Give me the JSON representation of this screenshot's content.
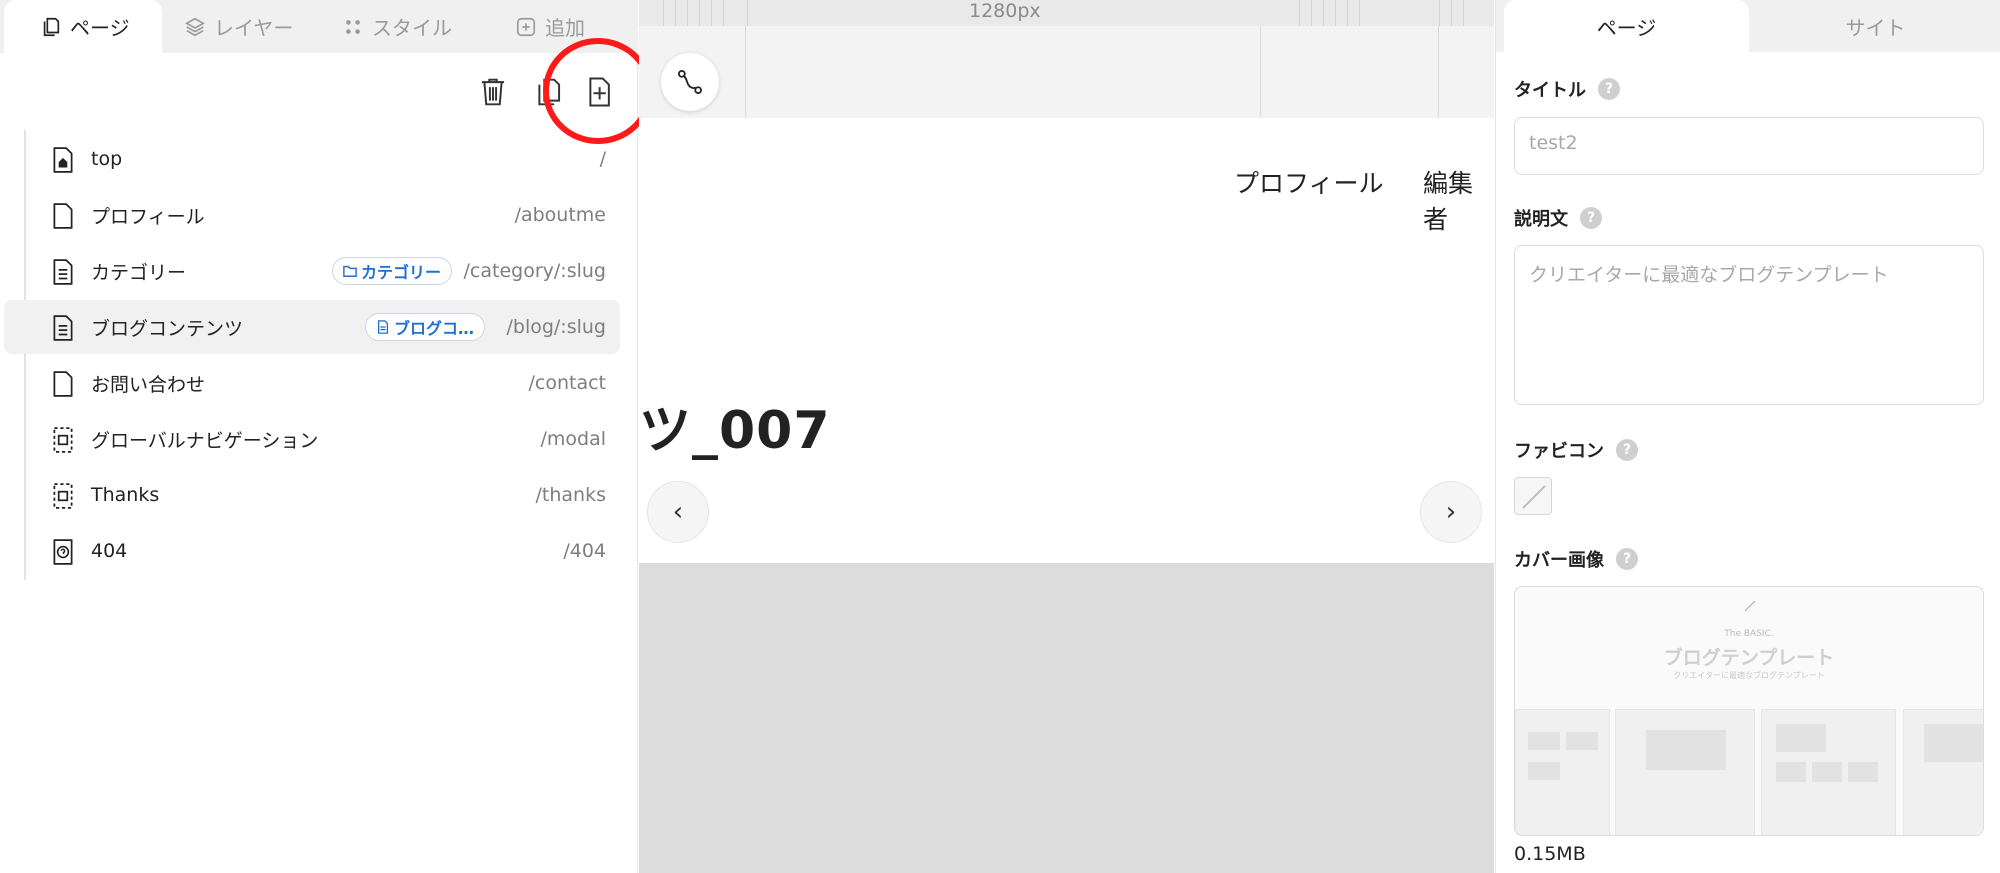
{
  "left_panel": {
    "tabs": [
      {
        "label": "ページ",
        "icon": "pages-icon",
        "active": true
      },
      {
        "label": "レイヤー",
        "icon": "layers-icon",
        "active": false
      },
      {
        "label": "スタイル",
        "icon": "style-icon",
        "active": false
      },
      {
        "label": "追加",
        "icon": "plus-square-icon",
        "active": false
      }
    ],
    "toolbar": [
      "trash-icon",
      "duplicate-icon",
      "add-page-icon"
    ],
    "pages": [
      {
        "name": "top",
        "path": "/",
        "icon": "home-page-icon",
        "tag": "",
        "selected": false
      },
      {
        "name": "プロフィール",
        "path": "/aboutme",
        "icon": "page-icon",
        "tag": "",
        "selected": false
      },
      {
        "name": "カテゴリー",
        "path": "/category/:slug",
        "icon": "document-icon",
        "tag": "カテゴリー",
        "tag_icon": "folder-icon",
        "selected": false
      },
      {
        "name": "ブログコンテンツ",
        "path": "/blog/:slug",
        "icon": "document-icon",
        "tag": "ブログコ…",
        "tag_icon": "document-small-icon",
        "selected": true
      },
      {
        "name": "お問い合わせ",
        "path": "/contact",
        "icon": "page-icon",
        "tag": "",
        "selected": false
      },
      {
        "name": "グローバルナビゲーション",
        "path": "/modal",
        "icon": "modal-icon",
        "tag": "",
        "selected": false
      },
      {
        "name": "Thanks",
        "path": "/thanks",
        "icon": "modal-icon",
        "tag": "",
        "selected": false
      },
      {
        "name": "404",
        "path": "/404",
        "icon": "not-found-icon",
        "tag": "",
        "selected": false
      }
    ]
  },
  "canvas": {
    "ruler_label": "1280px",
    "nav_links": [
      "プロフィール",
      "編集者"
    ],
    "hero_title": "ツ_007",
    "prev_arrow": "‹",
    "next_arrow": "›"
  },
  "right_panel": {
    "tabs": [
      {
        "label": "ページ",
        "active": true
      },
      {
        "label": "サイト",
        "active": false
      }
    ],
    "title_label": "タイトル",
    "title_value": "test2",
    "description_label": "説明文",
    "description_placeholder": "クリエイターに最適なブログテンプレート",
    "favicon_label": "ファビコン",
    "cover_label": "カバー画像",
    "cover_preview": {
      "brand": "The BASIC.",
      "title": "ブログテンプレート",
      "subtitle": "クリエイターに最適なブログテンプレート"
    },
    "cover_size": "0.15MB",
    "help_glyph": "?"
  },
  "colors": {
    "accent_blue": "#1f6fd1",
    "highlight_red": "#ff1a1a",
    "selected_row": "#f1f1f1",
    "canvas_bg": "#dcdcdc"
  }
}
